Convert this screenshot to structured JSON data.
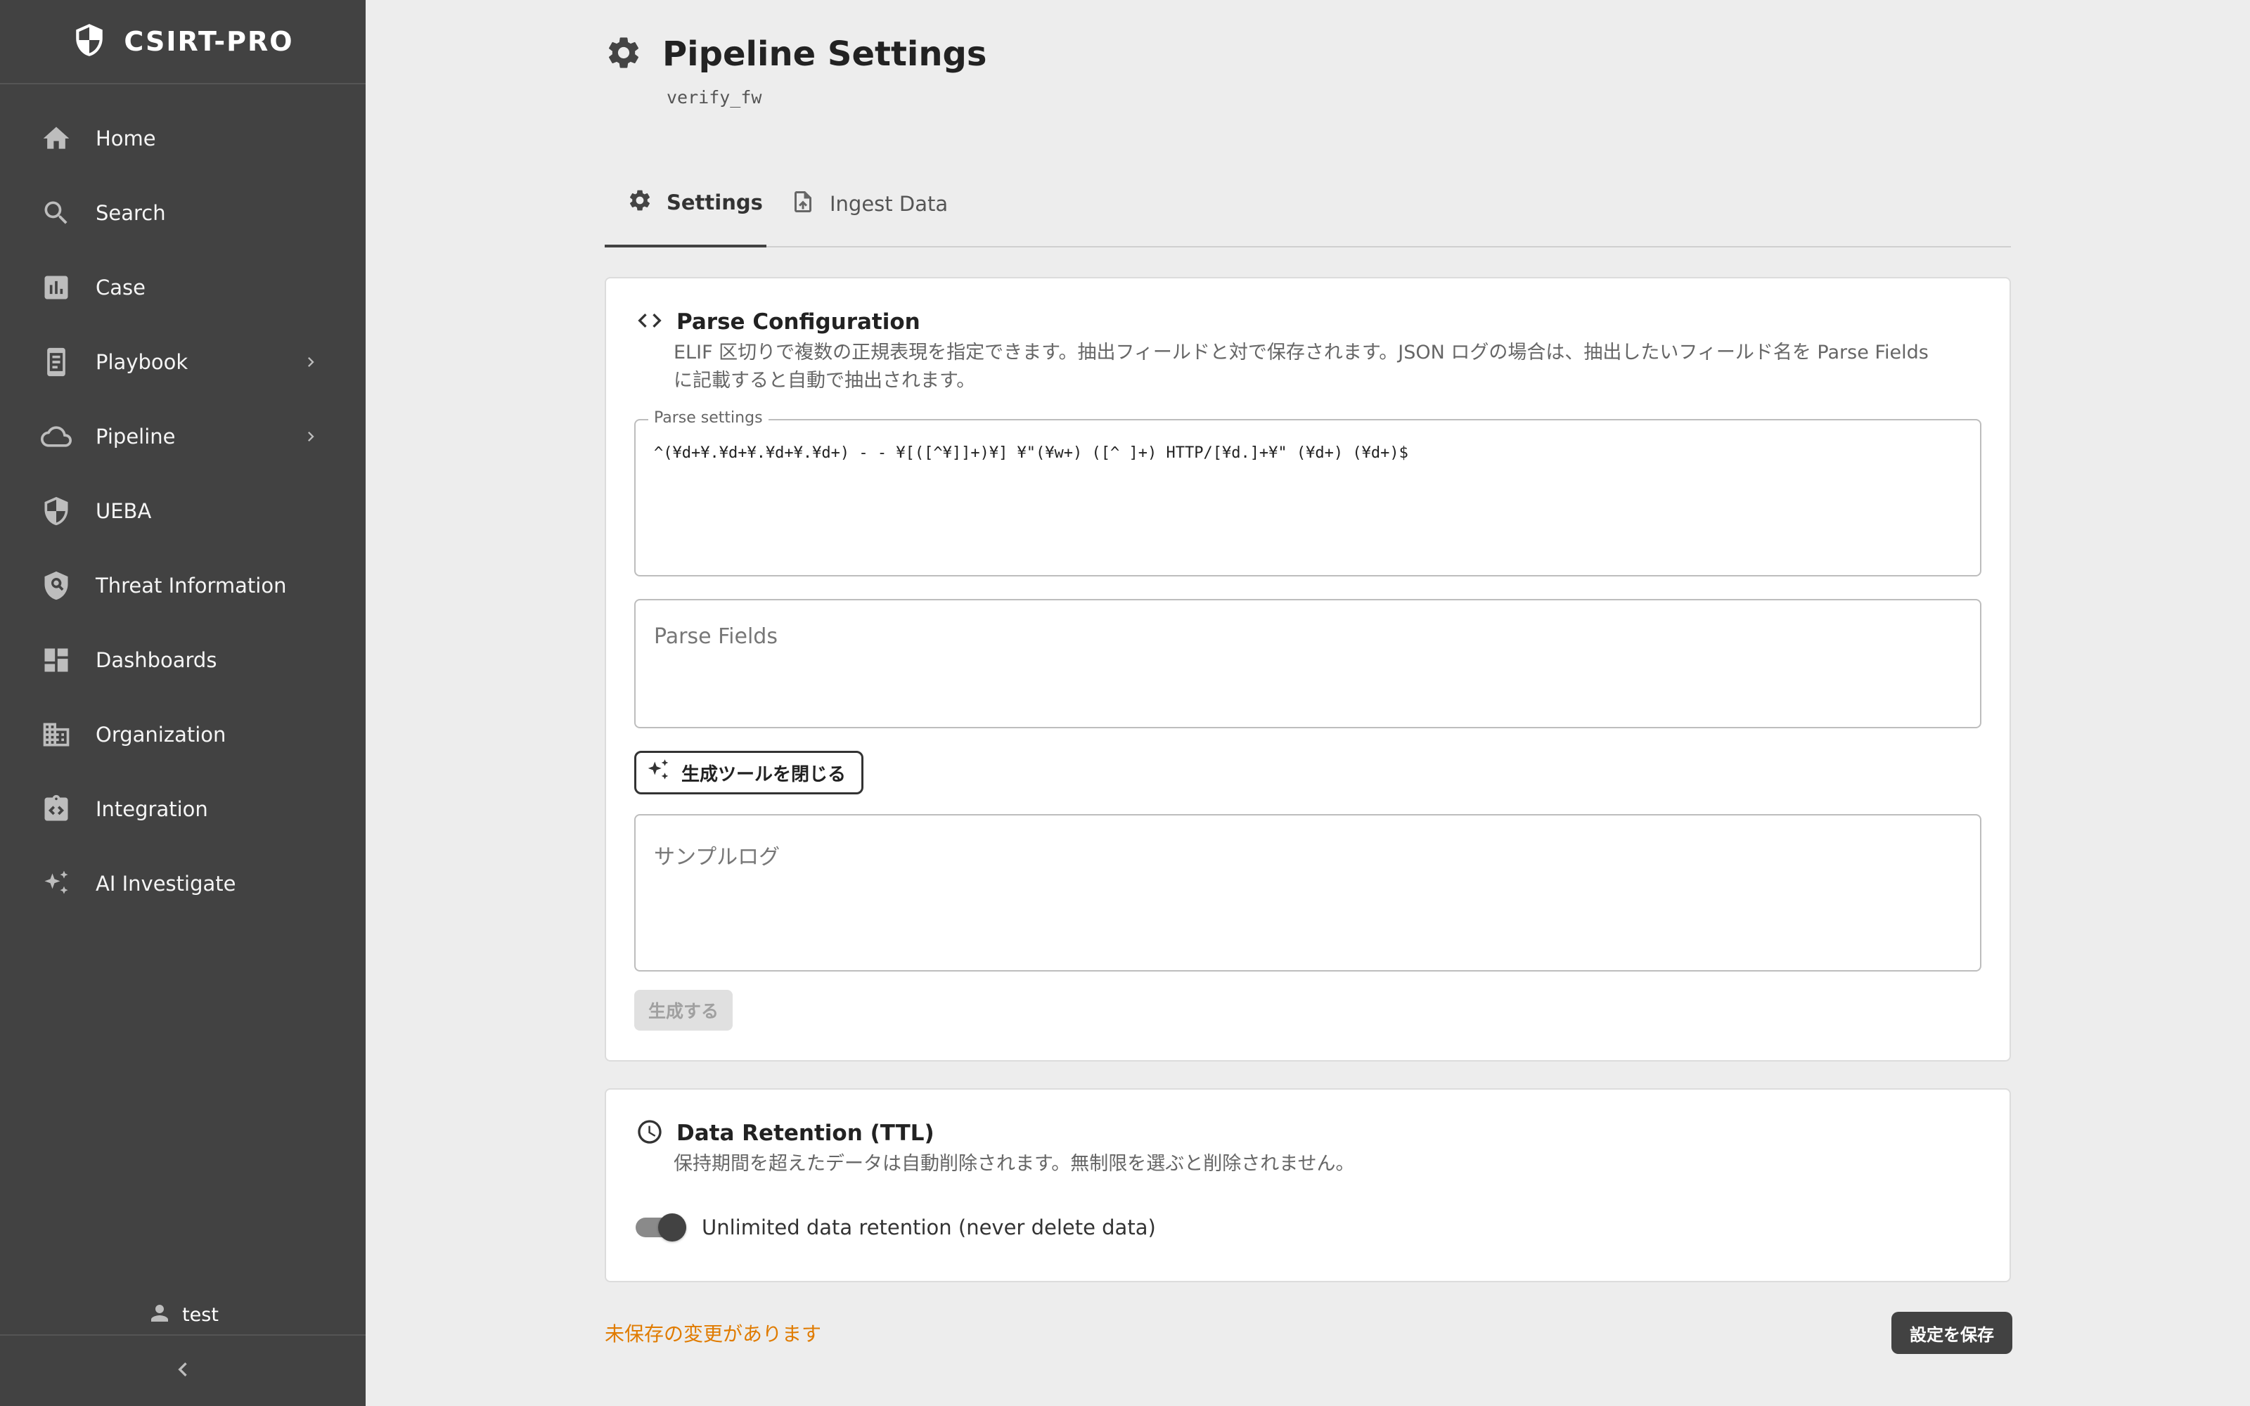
{
  "app": {
    "brand": "CSIRT-PRO"
  },
  "sidebar": {
    "items": [
      {
        "label": "Home",
        "icon": "home-icon"
      },
      {
        "label": "Search",
        "icon": "search-icon"
      },
      {
        "label": "Case",
        "icon": "bar-chart-icon"
      },
      {
        "label": "Playbook",
        "icon": "playbook-icon",
        "has_submenu": true
      },
      {
        "label": "Pipeline",
        "icon": "cloud-icon",
        "has_submenu": true
      },
      {
        "label": "UEBA",
        "icon": "shield-icon"
      },
      {
        "label": "Threat Information",
        "icon": "shield-search-icon"
      },
      {
        "label": "Dashboards",
        "icon": "dashboard-icon"
      },
      {
        "label": "Organization",
        "icon": "building-icon"
      },
      {
        "label": "Integration",
        "icon": "integration-icon"
      },
      {
        "label": "AI Investigate",
        "icon": "sparkle-icon"
      }
    ],
    "user": "test"
  },
  "page": {
    "title": "Pipeline Settings",
    "subtitle": "verify_fw"
  },
  "tabs": [
    {
      "label": "Settings",
      "active": true
    },
    {
      "label": "Ingest Data",
      "active": false
    }
  ],
  "parse_config": {
    "title": "Parse Configuration",
    "description": "ELIF 区切りで複数の正規表現を指定できます。抽出フィールドと対で保存されます。JSON ログの場合は、抽出したいフィールド名を Parse Fields に記載すると自動で抽出されます。",
    "parse_settings_label": "Parse settings",
    "parse_settings_value": "^(¥d+¥.¥d+¥.¥d+¥.¥d+) - - ¥[([^¥]]+)¥] ¥\"(¥w+) ([^ ]+) HTTP/[¥d.]+¥\" (¥d+) (¥d+)$",
    "parse_fields_placeholder": "Parse Fields",
    "toggle_tool_label": "生成ツールを閉じる",
    "sample_log_placeholder": "サンプルログ",
    "generate_label": "生成する"
  },
  "retention": {
    "title": "Data Retention (TTL)",
    "description": "保持期間を超えたデータは自動削除されます。無制限を選ぶと削除されません。",
    "switch_label": "Unlimited data retention (never delete data)",
    "unlimited": true
  },
  "footer": {
    "unsaved": "未保存の変更があります",
    "save_label": "設定を保存"
  },
  "colors": {
    "sidebar_bg": "#424242",
    "page_bg": "#ededed",
    "warning": "#e07b00",
    "primary_button": "#424242"
  }
}
